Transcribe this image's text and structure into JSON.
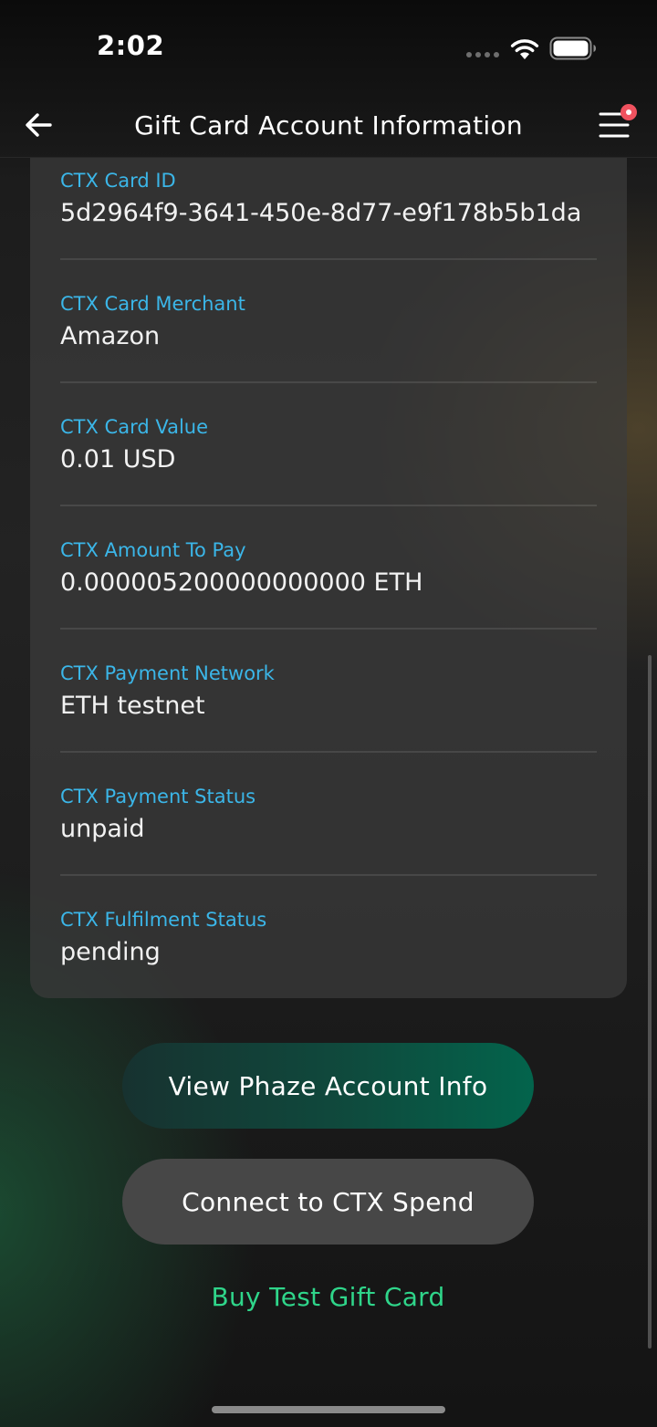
{
  "status_bar": {
    "time": "2:02"
  },
  "header": {
    "title": "Gift Card Account Information",
    "back_icon": "arrow-left-icon",
    "menu_icon": "hamburger-menu-icon",
    "notification_dot_color": "#f0525f"
  },
  "card": {
    "fields": [
      {
        "label": "CTX Card ID",
        "value": "5d2964f9-3641-450e-8d77-e9f178b5b1da"
      },
      {
        "label": "CTX Card Merchant",
        "value": "Amazon"
      },
      {
        "label": "CTX Card Value",
        "value": "0.01 USD"
      },
      {
        "label": "CTX Amount To Pay",
        "value": "0.000005200000000000 ETH"
      },
      {
        "label": "CTX Payment Network",
        "value": "ETH testnet"
      },
      {
        "label": "CTX Payment Status",
        "value": "unpaid"
      },
      {
        "label": "CTX Fulfilment Status",
        "value": "pending"
      }
    ],
    "label_color": "#3bb6e8"
  },
  "actions": {
    "view_phaze_label": "View Phaze Account Info",
    "connect_ctx_label": "Connect to CTX Spend",
    "buy_test_label": "Buy Test Gift Card",
    "accent_green": "#2fd58a",
    "phaze_gradient_end": "#03644c"
  }
}
